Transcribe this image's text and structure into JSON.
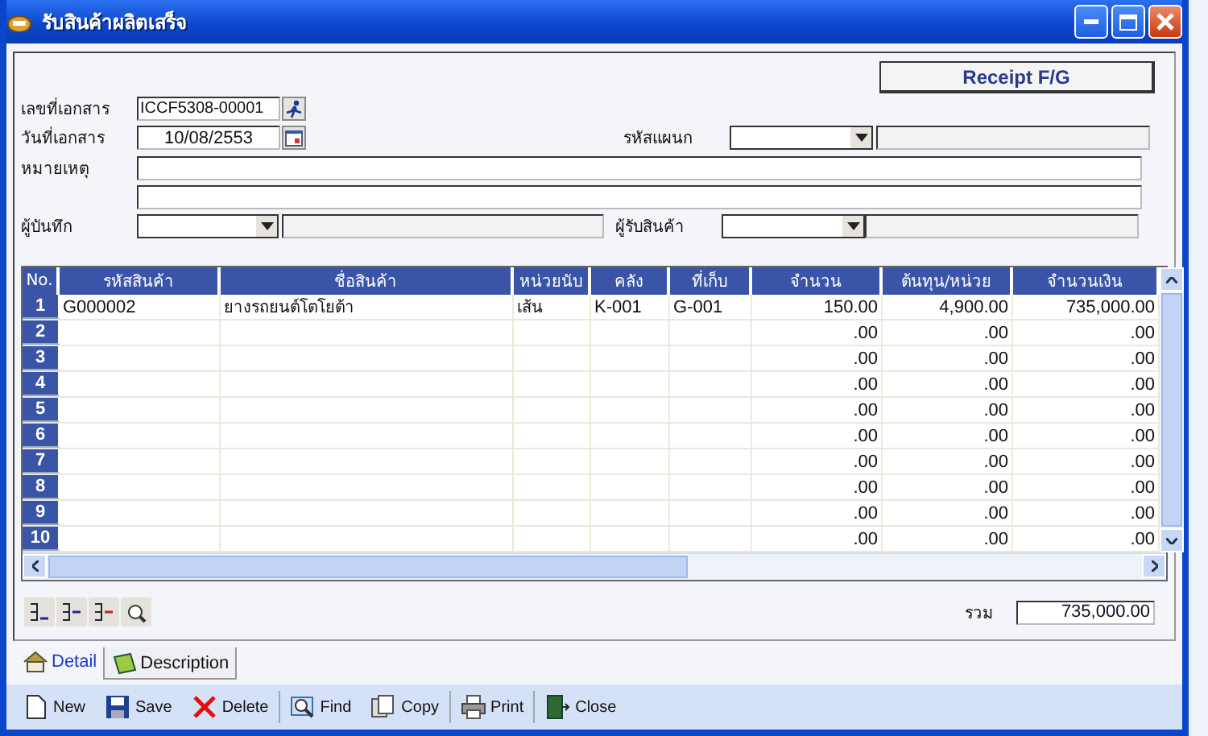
{
  "window": {
    "title": "รับสินค้าผลิตเสร็จ"
  },
  "header_badge": "Receipt F/G",
  "form": {
    "doc_no": {
      "label": "เลขที่เอกสาร",
      "value": "ICCF5308-00001"
    },
    "doc_date": {
      "label": "วันที่เอกสาร",
      "value": "10/08/2553"
    },
    "department": {
      "label": "รหัสแผนก"
    },
    "note": {
      "label": "หมายเหตุ"
    },
    "recorder": {
      "label": "ผู้บันทึก"
    },
    "receiver": {
      "label": "ผู้รับสินค้า"
    }
  },
  "grid": {
    "columns": [
      "No.",
      "รหัสสินค้า",
      "ชื่อสินค้า",
      "หน่วยนับ",
      "คลัง",
      "ที่เก็บ",
      "จำนวน",
      "ต้นทุน/หน่วย",
      "จำนวนเงิน"
    ],
    "rows": [
      {
        "no": "1",
        "code": "G000002",
        "name": "ยางรถยนต์โตโยต้า",
        "unit": "เส้น",
        "warehouse": "K-001",
        "location": "G-001",
        "qty": "150.00",
        "cost": "4,900.00",
        "amount": "735,000.00"
      },
      {
        "no": "2",
        "qty": ".00",
        "cost": ".00",
        "amount": ".00"
      },
      {
        "no": "3",
        "qty": ".00",
        "cost": ".00",
        "amount": ".00"
      },
      {
        "no": "4",
        "qty": ".00",
        "cost": ".00",
        "amount": ".00"
      },
      {
        "no": "5",
        "qty": ".00",
        "cost": ".00",
        "amount": ".00"
      },
      {
        "no": "6",
        "qty": ".00",
        "cost": ".00",
        "amount": ".00"
      },
      {
        "no": "7",
        "qty": ".00",
        "cost": ".00",
        "amount": ".00"
      },
      {
        "no": "8",
        "qty": ".00",
        "cost": ".00",
        "amount": ".00"
      },
      {
        "no": "9",
        "qty": ".00",
        "cost": ".00",
        "amount": ".00"
      },
      {
        "no": "10",
        "qty": ".00",
        "cost": ".00",
        "amount": ".00"
      }
    ]
  },
  "total": {
    "label": "รวม",
    "value": "735,000.00"
  },
  "tabs": [
    {
      "label": "Detail",
      "selected": true
    },
    {
      "label": "Description",
      "selected": false
    }
  ],
  "toolbar": [
    {
      "kind": "new",
      "label": "New"
    },
    {
      "kind": "save",
      "label": "Save"
    },
    {
      "kind": "delete",
      "label": "Delete"
    },
    {
      "kind": "find",
      "label": "Find"
    },
    {
      "kind": "copy",
      "label": "Copy"
    },
    {
      "kind": "print",
      "label": "Print"
    },
    {
      "kind": "close",
      "label": "Close"
    }
  ]
}
